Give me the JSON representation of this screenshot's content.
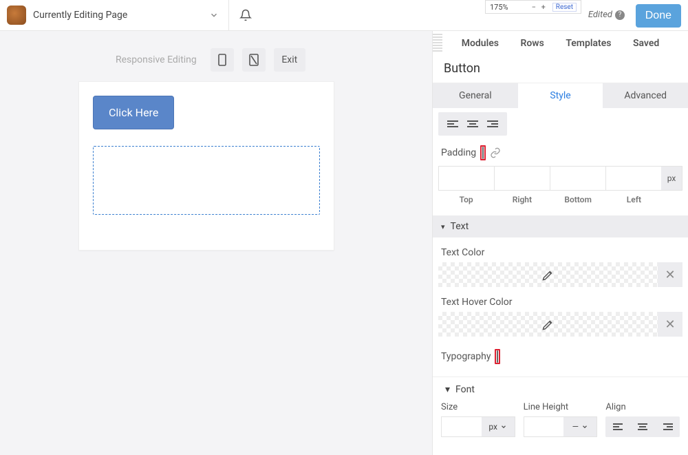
{
  "topbar": {
    "page_title": "Currently Editing Page",
    "zoom": "175%",
    "reset": "Reset",
    "edited": "Edited",
    "done": "Done"
  },
  "canvas": {
    "responsive_label": "Responsive Editing",
    "exit": "Exit",
    "cta_label": "Click Here"
  },
  "panel": {
    "tabs_main": [
      "Modules",
      "Rows",
      "Templates",
      "Saved"
    ],
    "module_title": "Button",
    "tabs_sub": {
      "general": "General",
      "style": "Style",
      "advanced": "Advanced"
    },
    "padding": {
      "label": "Padding",
      "unit": "px",
      "sides": {
        "top": "Top",
        "right": "Right",
        "bottom": "Bottom",
        "left": "Left"
      }
    },
    "text_section": "Text",
    "text_color": "Text Color",
    "text_hover_color": "Text Hover Color",
    "typography": "Typography",
    "font_section": "Font",
    "size": {
      "label": "Size",
      "unit": "px"
    },
    "line_height": {
      "label": "Line Height",
      "unit": "—"
    },
    "align": {
      "label": "Align"
    }
  }
}
